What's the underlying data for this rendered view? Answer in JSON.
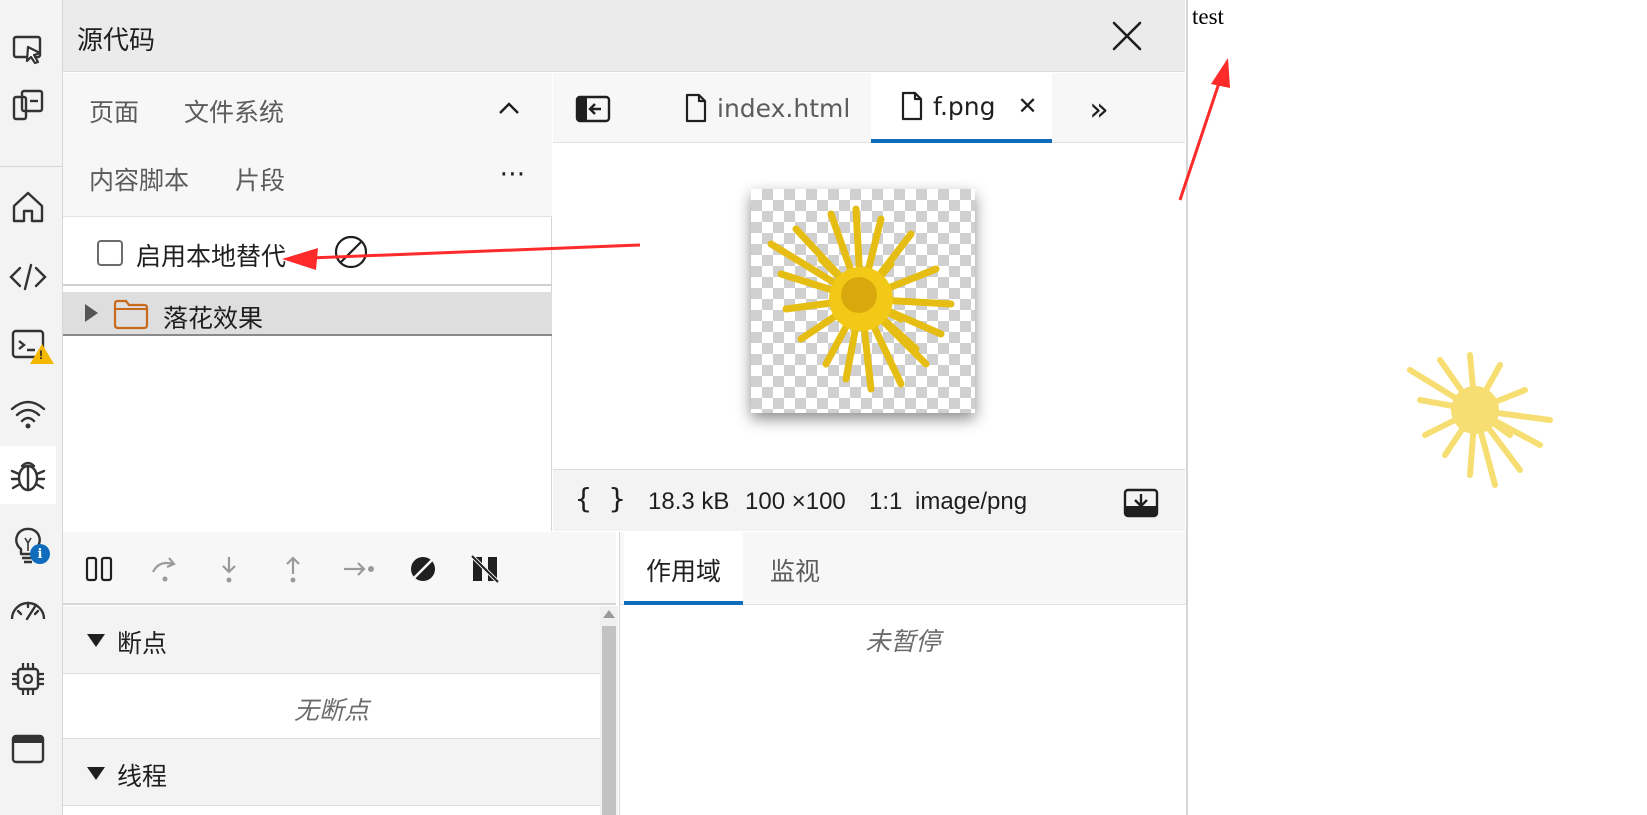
{
  "window": {
    "title": "源代码"
  },
  "navigator": {
    "tabs": [
      "页面",
      "文件系统",
      "内容脚本",
      "片段"
    ],
    "enable_local_overrides_label": "启用本地替代",
    "tree": [
      {
        "label": "落花效果",
        "type": "folder"
      }
    ]
  },
  "editor": {
    "tabs": [
      {
        "label": "index.html",
        "active": false
      },
      {
        "label": "f.png",
        "active": true
      }
    ],
    "status": {
      "braces": "{ }",
      "size": "18.3 kB",
      "dimensions": "100 ×100",
      "ratio": "1:1",
      "mime": "image/png"
    }
  },
  "debugger": {
    "breakpoints": {
      "label": "断点",
      "empty": "无断点"
    },
    "threads": {
      "label": "线程"
    },
    "scope_tabs": [
      "作用域",
      "监视"
    ],
    "scope_empty": "未暂停"
  },
  "page": {
    "text": "test"
  },
  "colors": {
    "accent": "#0f6cbd",
    "annotation": "#ff2a2a",
    "flower": "#f2c916",
    "warning": "#f5b800"
  }
}
